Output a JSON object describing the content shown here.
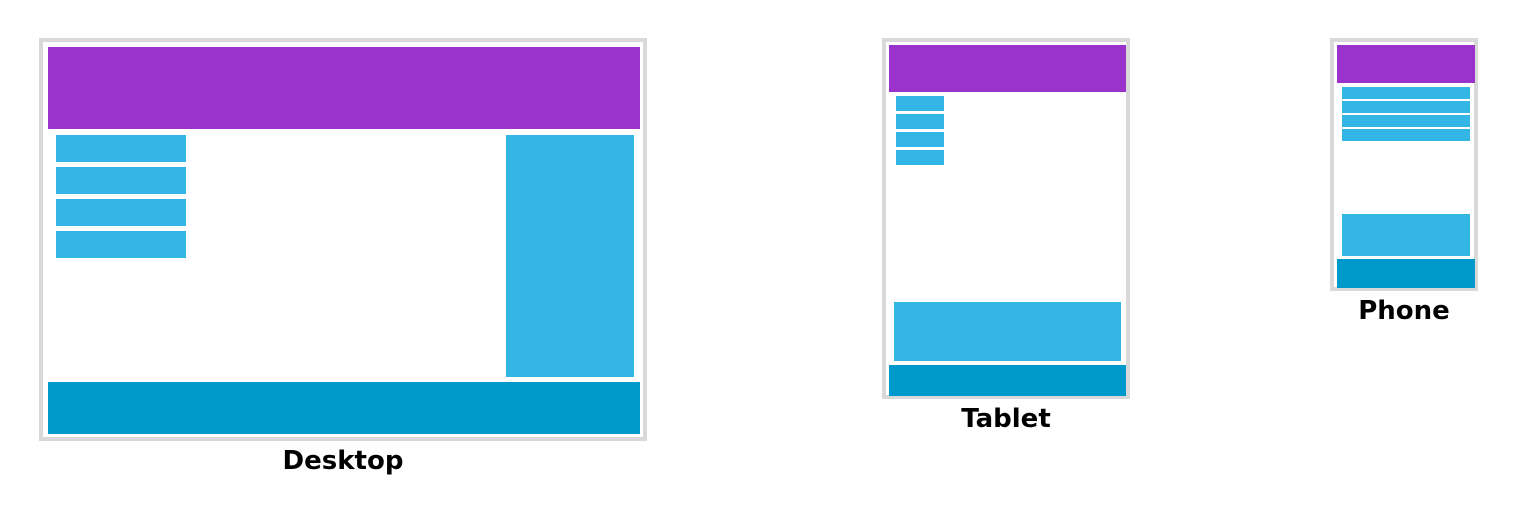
{
  "colors": {
    "frame_border": "#d9d9d9",
    "header": "#9933cc",
    "nav_and_sidebar": "#33b5e5",
    "footer": "#0099cc"
  },
  "layouts": [
    {
      "id": "desktop",
      "caption": "Desktop"
    },
    {
      "id": "tablet",
      "caption": "Tablet"
    },
    {
      "id": "phone",
      "caption": "Phone"
    }
  ]
}
